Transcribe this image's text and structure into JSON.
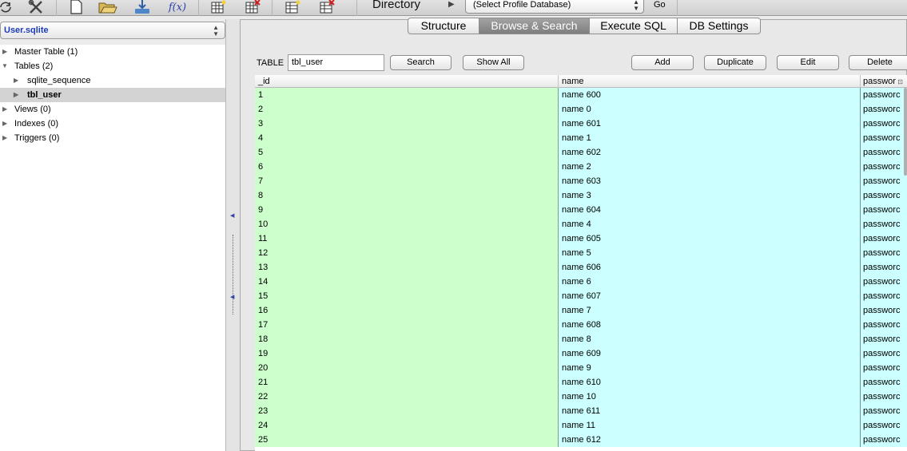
{
  "toolbar": {
    "fx_label": "f(x)",
    "directory_label": "Directory",
    "profile_select_value": "(Select Profile Database)",
    "go_label": "Go"
  },
  "sidebar": {
    "db_select_value": "User.sqlite",
    "tree": {
      "master_table": "Master Table (1)",
      "tables": "Tables (2)",
      "sqlite_sequence": "sqlite_sequence",
      "tbl_user": "tbl_user",
      "views": "Views (0)",
      "indexes": "Indexes (0)",
      "triggers": "Triggers (0)"
    }
  },
  "tabs": {
    "structure": "Structure",
    "browse": "Browse & Search",
    "execute": "Execute SQL",
    "settings": "DB Settings"
  },
  "browse": {
    "table_label": "TABLE",
    "table_value": "tbl_user",
    "search_label": "Search",
    "show_all_label": "Show All",
    "add_label": "Add",
    "duplicate_label": "Duplicate",
    "edit_label": "Edit",
    "delete_label": "Delete"
  },
  "grid": {
    "headers": [
      "_id",
      "name",
      "passwor"
    ],
    "rows": [
      [
        "1",
        "name 600",
        "passworc"
      ],
      [
        "2",
        "name 0",
        "passworc"
      ],
      [
        "3",
        "name 601",
        "passworc"
      ],
      [
        "4",
        "name 1",
        "passworc"
      ],
      [
        "5",
        "name 602",
        "passworc"
      ],
      [
        "6",
        "name 2",
        "passworc"
      ],
      [
        "7",
        "name 603",
        "passworc"
      ],
      [
        "8",
        "name 3",
        "passworc"
      ],
      [
        "9",
        "name 604",
        "passworc"
      ],
      [
        "10",
        "name 4",
        "passworc"
      ],
      [
        "11",
        "name 605",
        "passworc"
      ],
      [
        "12",
        "name 5",
        "passworc"
      ],
      [
        "13",
        "name 606",
        "passworc"
      ],
      [
        "14",
        "name 6",
        "passworc"
      ],
      [
        "15",
        "name 607",
        "passworc"
      ],
      [
        "16",
        "name 7",
        "passworc"
      ],
      [
        "17",
        "name 608",
        "passworc"
      ],
      [
        "18",
        "name 8",
        "passworc"
      ],
      [
        "19",
        "name 609",
        "passworc"
      ],
      [
        "20",
        "name 9",
        "passworc"
      ],
      [
        "21",
        "name 610",
        "passworc"
      ],
      [
        "22",
        "name 10",
        "passworc"
      ],
      [
        "23",
        "name 611",
        "passworc"
      ],
      [
        "24",
        "name 11",
        "passworc"
      ],
      [
        "25",
        "name 612",
        "passworc"
      ]
    ]
  },
  "colors": {
    "id_column_bg": "#ccffcc",
    "name_column_bg": "#ccffff",
    "db_name_color": "#1d3cb8",
    "active_tab_bg": "#8e8e8e",
    "selected_tree_bg": "#d3d3d3"
  },
  "icons": [
    "refresh-icon",
    "tools-icon",
    "new-file-icon",
    "open-folder-icon",
    "import-icon",
    "function-icon",
    "create-table-icon",
    "drop-table-icon",
    "create-index-icon",
    "drop-index-icon",
    "play-icon",
    "sort-indicator-icon"
  ]
}
